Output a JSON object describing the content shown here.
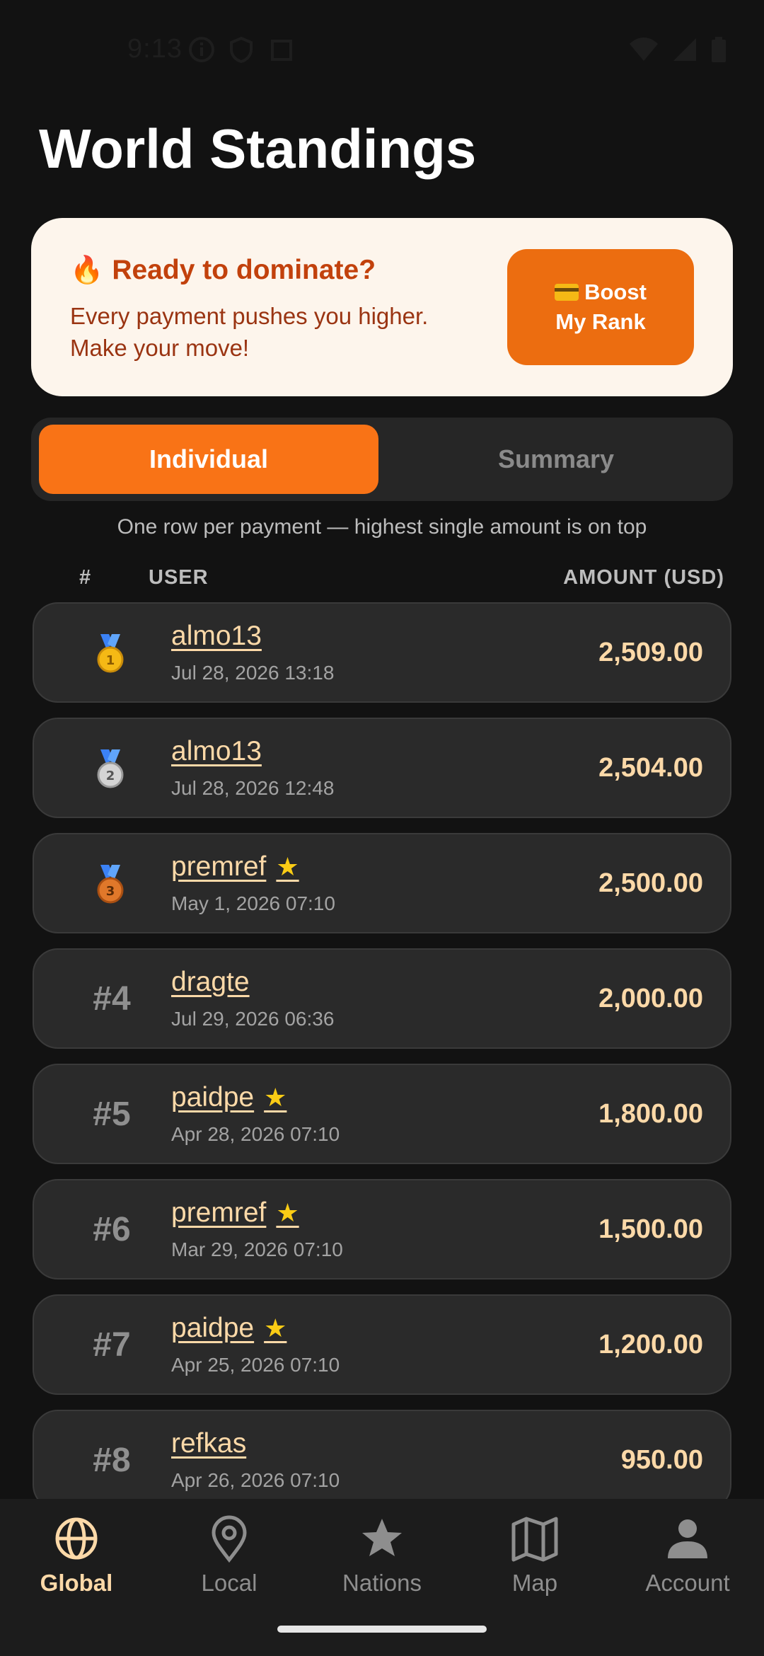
{
  "status_bar": {
    "time": "9:13"
  },
  "page": {
    "title": "World Standings"
  },
  "promo": {
    "heading": "Ready to dominate?",
    "body": "Every payment pushes you higher. Make your move!",
    "button_line1": "Boost",
    "button_line2": "My Rank"
  },
  "tabs": {
    "active": "Individual",
    "inactive": "Summary"
  },
  "subtitle": "One row per payment — highest single amount is on top",
  "columns": {
    "rank": "#",
    "user": "USER",
    "amount": "AMOUNT (USD)"
  },
  "rows": [
    {
      "rank": "1",
      "medal": "gold",
      "user": "almo13",
      "star": false,
      "date": "Jul 28, 2026  13:18",
      "amount": "2,509.00"
    },
    {
      "rank": "2",
      "medal": "silver",
      "user": "almo13",
      "star": false,
      "date": "Jul 28, 2026  12:48",
      "amount": "2,504.00"
    },
    {
      "rank": "3",
      "medal": "bronze",
      "user": "premref",
      "star": true,
      "date": "May 1, 2026  07:10",
      "amount": "2,500.00"
    },
    {
      "rank": "#4",
      "medal": "",
      "user": "dragte",
      "star": false,
      "date": "Jul 29, 2026  06:36",
      "amount": "2,000.00"
    },
    {
      "rank": "#5",
      "medal": "",
      "user": "paidpe",
      "star": true,
      "date": "Apr 28, 2026  07:10",
      "amount": "1,800.00"
    },
    {
      "rank": "#6",
      "medal": "",
      "user": "premref",
      "star": true,
      "date": "Mar 29, 2026  07:10",
      "amount": "1,500.00"
    },
    {
      "rank": "#7",
      "medal": "",
      "user": "paidpe",
      "star": true,
      "date": "Apr 25, 2026  07:10",
      "amount": "1,200.00"
    },
    {
      "rank": "#8",
      "medal": "",
      "user": "refkas",
      "star": false,
      "date": "Apr 26, 2026  07:10",
      "amount": "950.00"
    }
  ],
  "nav": {
    "global": "Global",
    "local": "Local",
    "nations": "Nations",
    "map": "Map",
    "account": "Account"
  },
  "colors": {
    "accent": "#f97316",
    "highlight_text": "#fcd9a8",
    "gold": "#f5b915",
    "silver": "#c9c9c9",
    "bronze": "#e0782a"
  }
}
